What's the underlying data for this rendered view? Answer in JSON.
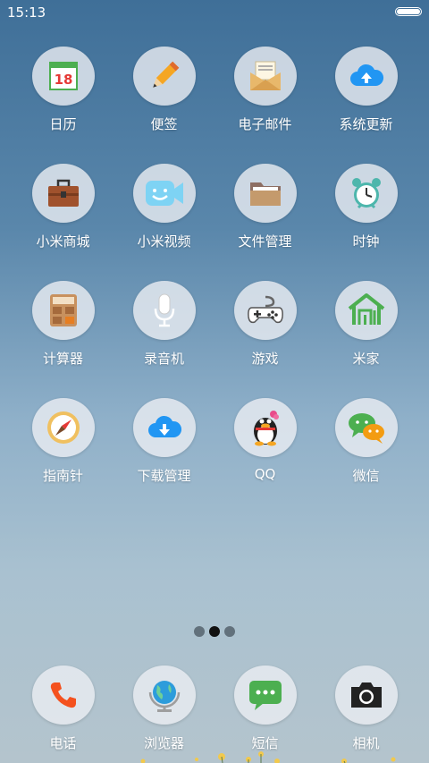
{
  "status": {
    "time": "15:13"
  },
  "apps": [
    {
      "label": "日历",
      "icon": "calendar-icon",
      "day": "18"
    },
    {
      "label": "便签",
      "icon": "pencil-icon"
    },
    {
      "label": "电子邮件",
      "icon": "mail-icon"
    },
    {
      "label": "系统更新",
      "icon": "cloud-upload-icon"
    },
    {
      "label": "小米商城",
      "icon": "briefcase-icon"
    },
    {
      "label": "小米视频",
      "icon": "video-camera-icon"
    },
    {
      "label": "文件管理",
      "icon": "folder-icon"
    },
    {
      "label": "时钟",
      "icon": "alarm-clock-icon"
    },
    {
      "label": "计算器",
      "icon": "calculator-icon"
    },
    {
      "label": "录音机",
      "icon": "microphone-icon"
    },
    {
      "label": "游戏",
      "icon": "gamepad-icon"
    },
    {
      "label": "米家",
      "icon": "mi-home-icon"
    },
    {
      "label": "指南针",
      "icon": "compass-icon"
    },
    {
      "label": "下载管理",
      "icon": "cloud-download-icon"
    },
    {
      "label": "QQ",
      "icon": "qq-penguin-icon"
    },
    {
      "label": "微信",
      "icon": "wechat-bubbles-icon"
    }
  ],
  "pager": {
    "total": 3,
    "active": 2
  },
  "dock": [
    {
      "label": "电话",
      "icon": "phone-icon"
    },
    {
      "label": "浏览器",
      "icon": "globe-icon"
    },
    {
      "label": "短信",
      "icon": "message-icon"
    },
    {
      "label": "相机",
      "icon": "camera-icon"
    }
  ]
}
